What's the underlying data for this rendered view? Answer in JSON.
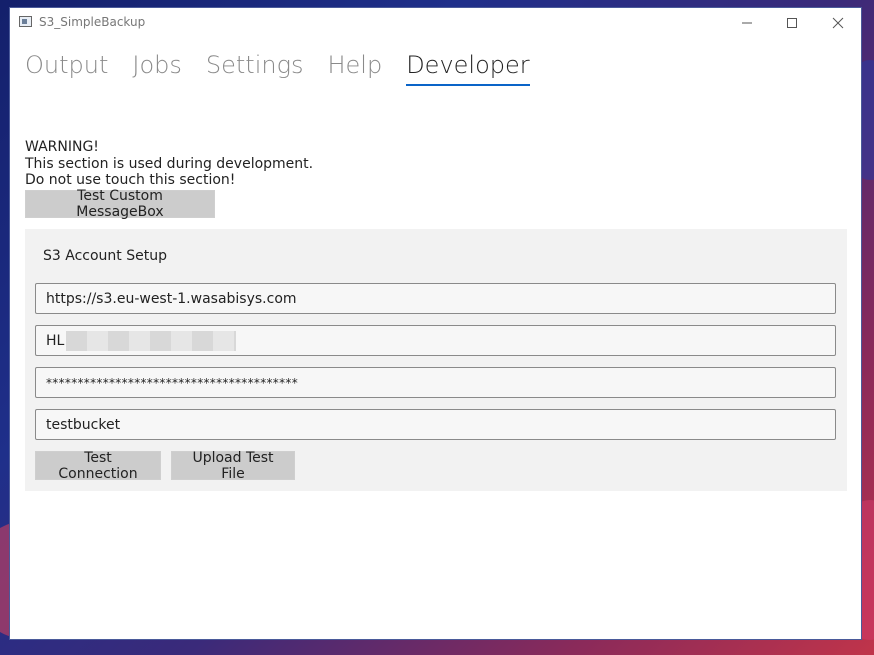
{
  "window": {
    "title": "S3_SimpleBackup"
  },
  "tabs": [
    {
      "label": "Output",
      "active": false
    },
    {
      "label": "Jobs",
      "active": false
    },
    {
      "label": "Settings",
      "active": false
    },
    {
      "label": "Help",
      "active": false
    },
    {
      "label": "Developer",
      "active": true
    }
  ],
  "warning": {
    "line1": "WARNING!",
    "line2": "This section is used during development.",
    "line3": "Do not use touch this section!"
  },
  "buttons": {
    "test_messagebox": "Test Custom MessageBox",
    "test_connection": "Test Connection",
    "upload_test_file": "Upload Test File"
  },
  "s3": {
    "section_title": "S3 Account Setup",
    "endpoint": "https://s3.eu-west-1.wasabisys.com",
    "access_key_prefix": "HL",
    "secret_key_masked": "****************************************",
    "bucket": "testbucket"
  },
  "colors": {
    "accent": "#0a64c8",
    "button_bg": "#cccccc",
    "panel_bg": "#f2f2f2"
  }
}
